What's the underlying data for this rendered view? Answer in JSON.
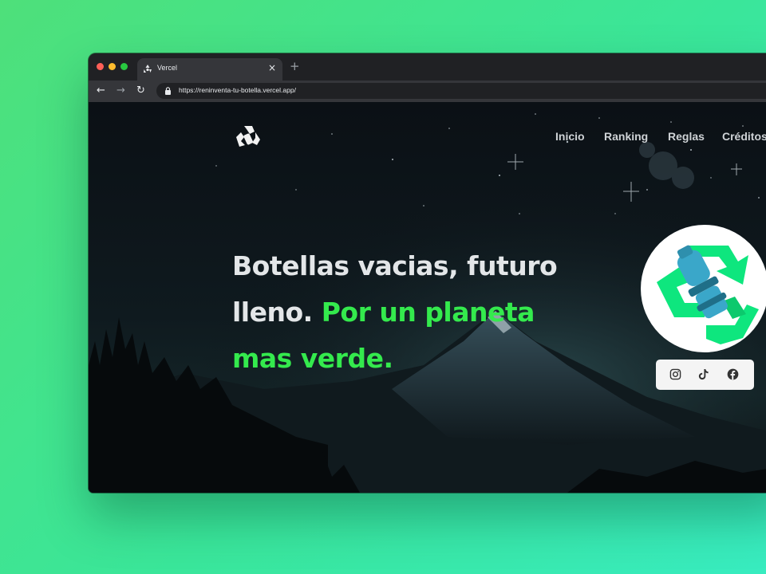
{
  "browser": {
    "tab_title": "Vercel",
    "tab_close": "×",
    "new_tab": "+",
    "url": "https://reninventa-tu-botella.vercel.app/",
    "back_icon": "←",
    "forward_icon": "→",
    "reload_icon": "↻"
  },
  "nav": {
    "items": [
      {
        "label": "Inicio"
      },
      {
        "label": "Ranking"
      },
      {
        "label": "Reglas"
      },
      {
        "label": "Créditos"
      }
    ]
  },
  "hero": {
    "line1": "Botellas vacias, futuro",
    "line2_white": "lleno.",
    "line2_accent": "Por un planeta",
    "line3_accent": "mas verde."
  },
  "social": {
    "icons": [
      "instagram-icon",
      "tiktok-icon",
      "facebook-icon"
    ]
  },
  "colors": {
    "accent_green": "#34ea4d",
    "recycle_green": "#0ee67e",
    "bottle_blue": "#3aa7c9",
    "background_gradient_start": "#4ee07a",
    "background_gradient_end": "#38ecc0"
  }
}
